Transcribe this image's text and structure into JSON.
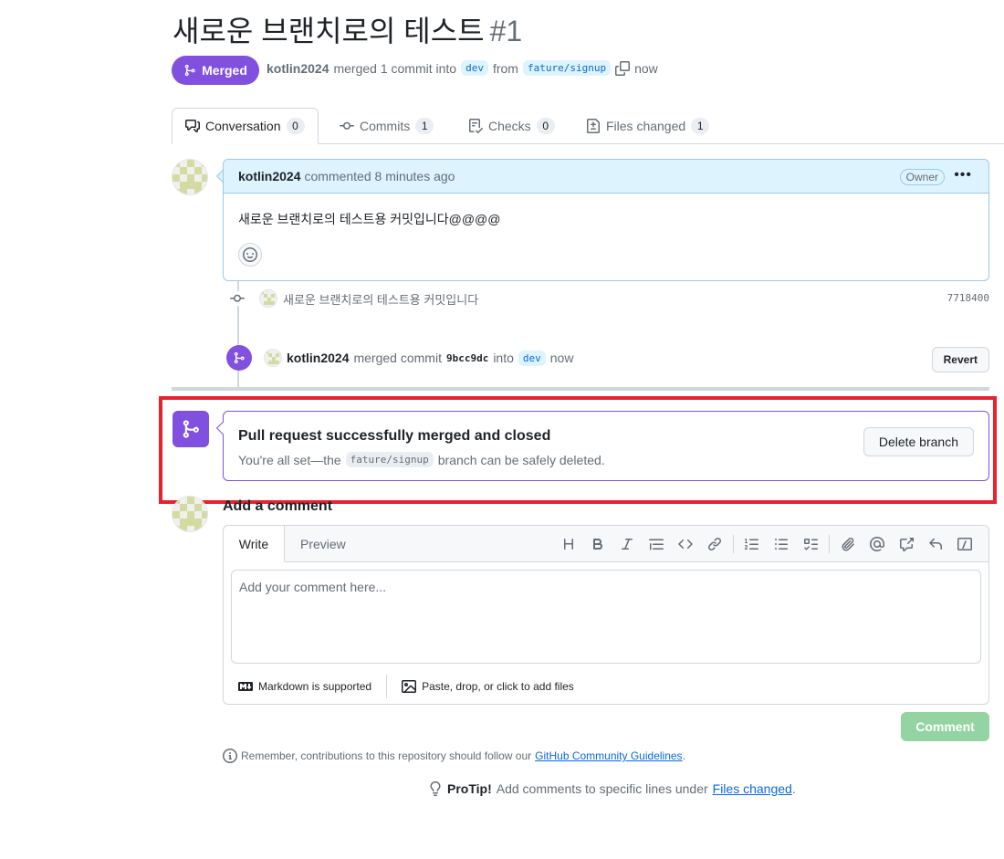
{
  "pr": {
    "title": "새로운 브랜치로의 테스트",
    "number": "#1",
    "state_label": "Merged",
    "author": "kotlin2024",
    "merge_text": "merged 1 commit into",
    "base_branch": "dev",
    "from_text": "from",
    "head_branch": "fature/signup",
    "time": "now"
  },
  "tabs": [
    {
      "label": "Conversation",
      "count": "0"
    },
    {
      "label": "Commits",
      "count": "1"
    },
    {
      "label": "Checks",
      "count": "0"
    },
    {
      "label": "Files changed",
      "count": "1"
    }
  ],
  "comment": {
    "author": "kotlin2024",
    "action": "commented 8 minutes ago",
    "badge": "Owner",
    "body": "새로운 브랜치로의 테스트용 커밋입니다@@@@"
  },
  "commit": {
    "message": "새로운 브랜치로의 테스트용 커밋입니다",
    "sha": "7718400"
  },
  "merge_event": {
    "author": "kotlin2024",
    "text": "merged commit",
    "sha": "9bcc9dc",
    "into": "into",
    "branch": "dev",
    "time": "now",
    "revert_label": "Revert"
  },
  "merged_box": {
    "title": "Pull request successfully merged and closed",
    "sub_prefix": "You're all set—the",
    "branch": "fature/signup",
    "sub_suffix": "branch can be safely deleted.",
    "delete_label": "Delete branch"
  },
  "add_comment": {
    "title": "Add a comment",
    "tab_write": "Write",
    "tab_preview": "Preview",
    "placeholder": "Add your comment here...",
    "markdown_label": "Markdown is supported",
    "files_label": "Paste, drop, or click to add files",
    "submit_label": "Comment"
  },
  "footer": {
    "guidelines_prefix": "Remember, contributions to this repository should follow our",
    "guidelines_link": "GitHub Community Guidelines",
    "guidelines_suffix": ".",
    "protip_label": "ProTip!",
    "protip_text": "Add comments to specific lines under",
    "protip_link": "Files changed",
    "protip_suffix": "."
  },
  "colors": {
    "merged_purple": "#8250df",
    "comment_header_bg": "#ddf4ff",
    "disabled_green": "#94d3a2",
    "highlight_red": "#e5232c",
    "link_blue": "#0969da"
  }
}
